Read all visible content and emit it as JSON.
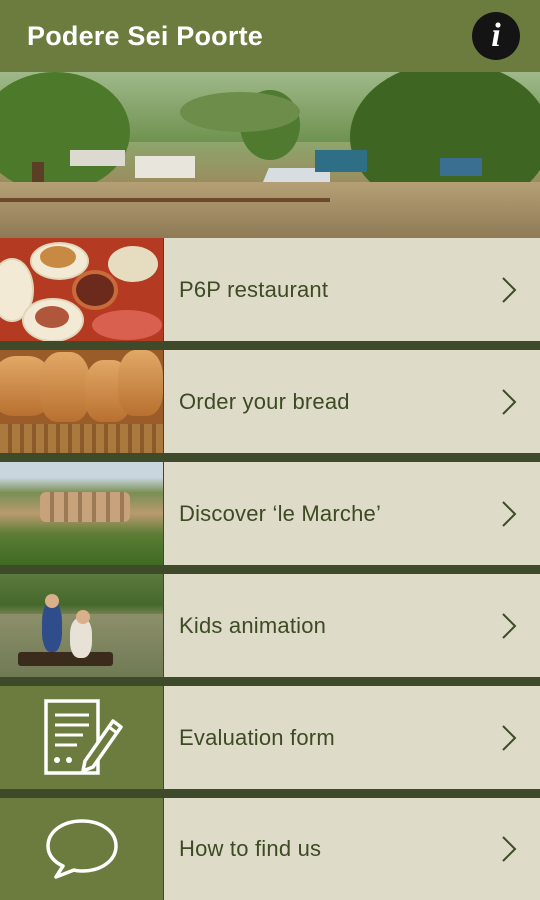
{
  "header": {
    "title": "Podere Sei Poorte",
    "info_label": "i"
  },
  "menu": [
    {
      "label": "P6P restaurant",
      "thumb": "restaurant-food-photo"
    },
    {
      "label": "Order your bread",
      "thumb": "bread-basket-photo"
    },
    {
      "label": "Discover ‘le Marche’",
      "thumb": "hill-town-photo"
    },
    {
      "label": "Kids animation",
      "thumb": "kids-raft-photo"
    },
    {
      "label": "Evaluation form",
      "thumb": "form-pen-icon"
    },
    {
      "label": "How to find us",
      "thumb": "speech-bubble-icon"
    }
  ],
  "colors": {
    "header": "#6b7c3e",
    "panel": "#dedbc8",
    "label": "#3d4a24"
  }
}
